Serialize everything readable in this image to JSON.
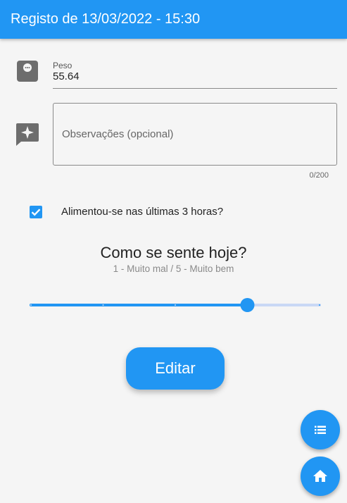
{
  "appbar": {
    "title": "Registo de 13/03/2022 - 15:30"
  },
  "peso": {
    "label": "Peso",
    "value": "55.64",
    "icon": "scale-icon"
  },
  "observacoes": {
    "placeholder": "Observações (opcional)",
    "counter": "0/200",
    "icon": "feedback-icon"
  },
  "alimentou": {
    "label": "Alimentou-se nas últimas 3 horas?",
    "checked": true
  },
  "humor": {
    "question": "Como se sente hoje?",
    "hint": "1 - Muito mal / 5 - Muito bem",
    "slider": {
      "min": 1,
      "max": 5,
      "value": 4
    }
  },
  "edit_button": {
    "label": "Editar"
  },
  "fabs": {
    "list_icon": "list-icon",
    "home_icon": "home-icon"
  },
  "colors": {
    "primary": "#2196f3",
    "track_inactive": "#c9d8f5",
    "background": "#f5f5f5"
  }
}
